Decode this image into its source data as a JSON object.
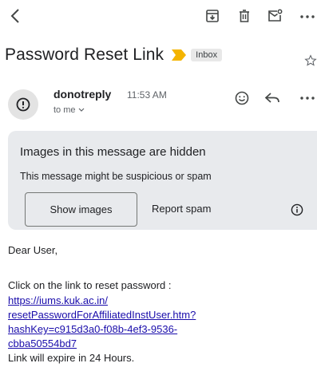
{
  "subject": {
    "title": "Password Reset Link",
    "label_chip": "Inbox"
  },
  "sender": {
    "name": "donotreply",
    "time": "11:53 AM",
    "recipient": "to me"
  },
  "warning": {
    "title": "Images in this message are hidden",
    "text": "This message might be suspicious or spam",
    "show_images_label": "Show images",
    "report_spam_label": "Report spam"
  },
  "message": {
    "greeting": "Dear User,",
    "instruction": "Click on the link to reset password :",
    "link_lines": [
      "https://iums.kuk.ac.in/",
      "resetPasswordForAffiliatedInstUser.htm?",
      "hashKey=c915d3a0-f08b-4ef3-9536-",
      "cbba50554bd7"
    ],
    "expiry": "Link will expire in 24 Hours."
  },
  "colors": {
    "important_marker": "#f4b400",
    "link": "#1a0dab",
    "warning_bg": "#e8eaed"
  },
  "icons": {
    "back": "back-arrow-icon",
    "archive": "archive-icon",
    "delete": "trash-icon",
    "mark_unread": "mark-unread-icon",
    "more": "more-horizontal-icon",
    "important": "important-marker-icon",
    "star": "star-icon",
    "avatar": "alert-circle-icon",
    "emoji": "emoji-reaction-icon",
    "reply": "reply-icon",
    "info": "info-icon"
  }
}
